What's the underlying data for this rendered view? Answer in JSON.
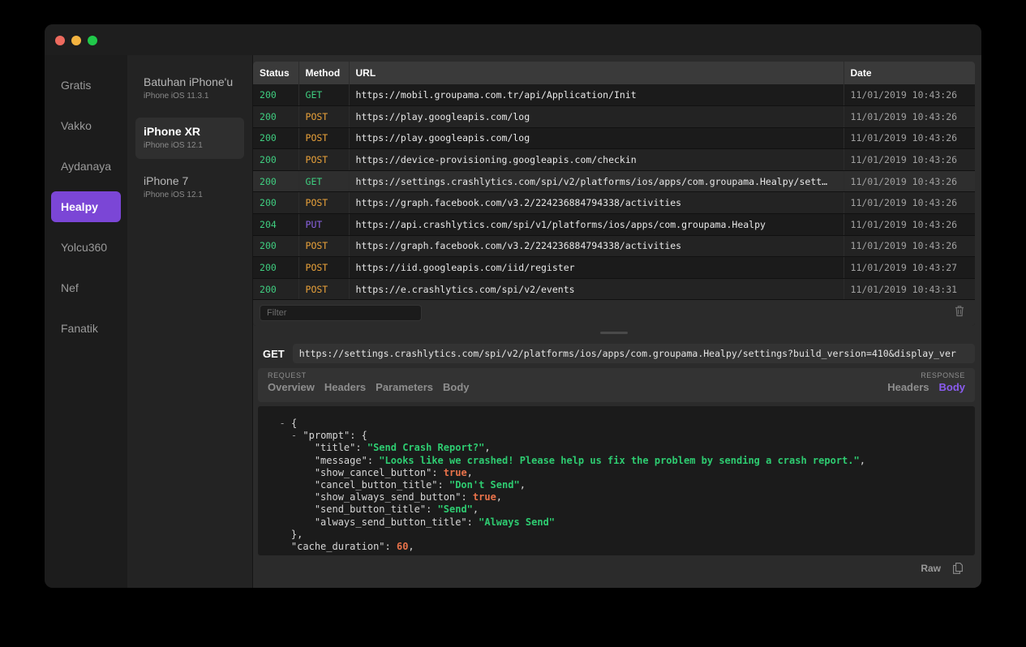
{
  "window": {
    "traffic_lights": [
      "close",
      "minimize",
      "maximize"
    ],
    "accent_color": "#7b46d6"
  },
  "app_sidebar": {
    "items": [
      {
        "label": "Gratis",
        "selected": false
      },
      {
        "label": "Vakko",
        "selected": false
      },
      {
        "label": "Aydanaya",
        "selected": false
      },
      {
        "label": "Healpy",
        "selected": true
      },
      {
        "label": "Yolcu360",
        "selected": false
      },
      {
        "label": "Nef",
        "selected": false
      },
      {
        "label": "Fanatik",
        "selected": false
      }
    ]
  },
  "device_panel": {
    "items": [
      {
        "name": "Batuhan iPhone'u",
        "os": "iPhone iOS 11.3.1",
        "selected": false
      },
      {
        "name": "iPhone XR",
        "os": "iPhone iOS 12.1",
        "selected": true
      },
      {
        "name": "iPhone 7",
        "os": "iPhone iOS 12.1",
        "selected": false
      }
    ]
  },
  "requests_table": {
    "columns": [
      "Status",
      "Method",
      "URL",
      "Date"
    ],
    "rows": [
      {
        "status": "200",
        "method": "GET",
        "url": "https://mobil.groupama.com.tr/api/Application/Init",
        "date": "11/01/2019 10:43:26",
        "active": false
      },
      {
        "status": "200",
        "method": "POST",
        "url": "https://play.googleapis.com/log",
        "date": "11/01/2019 10:43:26",
        "active": false
      },
      {
        "status": "200",
        "method": "POST",
        "url": "https://play.googleapis.com/log",
        "date": "11/01/2019 10:43:26",
        "active": false
      },
      {
        "status": "200",
        "method": "POST",
        "url": "https://device-provisioning.googleapis.com/checkin",
        "date": "11/01/2019 10:43:26",
        "active": false
      },
      {
        "status": "200",
        "method": "GET",
        "url": "https://settings.crashlytics.com/spi/v2/platforms/ios/apps/com.groupama.Healpy/sett…",
        "date": "11/01/2019 10:43:26",
        "active": true
      },
      {
        "status": "200",
        "method": "POST",
        "url": "https://graph.facebook.com/v3.2/224236884794338/activities",
        "date": "11/01/2019 10:43:26",
        "active": false
      },
      {
        "status": "204",
        "method": "PUT",
        "url": "https://api.crashlytics.com/spi/v1/platforms/ios/apps/com.groupama.Healpy",
        "date": "11/01/2019 10:43:26",
        "active": false
      },
      {
        "status": "200",
        "method": "POST",
        "url": "https://graph.facebook.com/v3.2/224236884794338/activities",
        "date": "11/01/2019 10:43:26",
        "active": false
      },
      {
        "status": "200",
        "method": "POST",
        "url": "https://iid.googleapis.com/iid/register",
        "date": "11/01/2019 10:43:27",
        "active": false
      },
      {
        "status": "200",
        "method": "POST",
        "url": "https://e.crashlytics.com/spi/v2/events",
        "date": "11/01/2019 10:43:31",
        "active": false
      }
    ]
  },
  "filter": {
    "value": "",
    "placeholder": "Filter",
    "delete_icon": "trash-icon"
  },
  "detail": {
    "method": "GET",
    "url": "https://settings.crashlytics.com/spi/v2/platforms/ios/apps/com.groupama.Healpy/settings?build_version=410&display_ver",
    "request_caption": "REQUEST",
    "request_tabs": [
      {
        "label": "Overview",
        "active": false
      },
      {
        "label": "Headers",
        "active": false
      },
      {
        "label": "Parameters",
        "active": false
      },
      {
        "label": "Body",
        "active": false
      }
    ],
    "response_caption": "RESPONSE",
    "response_tabs": [
      {
        "label": "Headers",
        "active": false
      },
      {
        "label": "Body",
        "active": true
      }
    ]
  },
  "json_body": {
    "lines": [
      {
        "indent": 1,
        "toggle": "-",
        "text": "{"
      },
      {
        "indent": 2,
        "toggle": "-",
        "key": "\"prompt\"",
        "punct": ": {"
      },
      {
        "indent": 4,
        "key": "\"title\"",
        "punct": ": ",
        "str": "\"Send Crash Report?\"",
        "tail": ","
      },
      {
        "indent": 4,
        "key": "\"message\"",
        "punct": ": ",
        "str": "\"Looks like we crashed! Please help us fix the problem by sending a crash report.\"",
        "tail": ","
      },
      {
        "indent": 4,
        "key": "\"show_cancel_button\"",
        "punct": ": ",
        "bool": "true",
        "tail": ","
      },
      {
        "indent": 4,
        "key": "\"cancel_button_title\"",
        "punct": ": ",
        "str": "\"Don't Send\"",
        "tail": ","
      },
      {
        "indent": 4,
        "key": "\"show_always_send_button\"",
        "punct": ": ",
        "bool": "true",
        "tail": ","
      },
      {
        "indent": 4,
        "key": "\"send_button_title\"",
        "punct": ": ",
        "str": "\"Send\"",
        "tail": ","
      },
      {
        "indent": 4,
        "key": "\"always_send_button_title\"",
        "punct": ": ",
        "str": "\"Always Send\"",
        "tail": ""
      },
      {
        "indent": 2,
        "text": "},"
      },
      {
        "indent": 2,
        "key": "\"cache_duration\"",
        "punct": ": ",
        "num": "60",
        "tail": ","
      }
    ]
  },
  "json_footer": {
    "raw_label": "Raw",
    "copy_icon": "copy-icon"
  }
}
